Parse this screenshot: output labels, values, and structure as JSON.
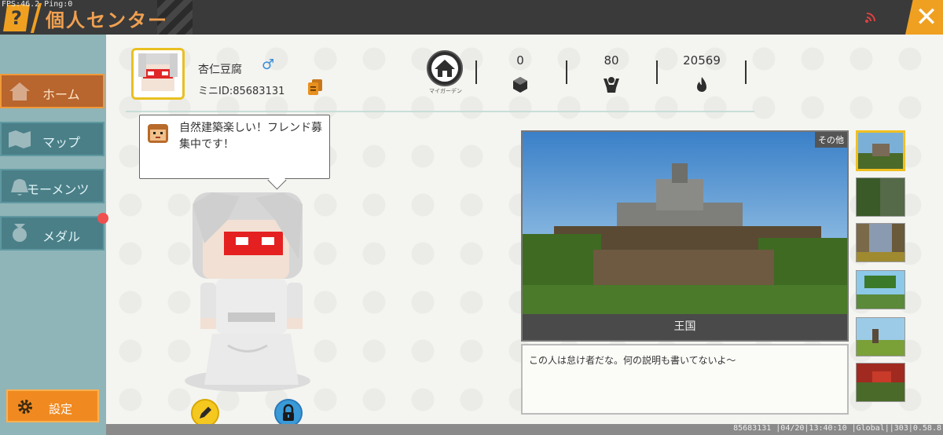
{
  "debug": {
    "fps_text": "FPS:46.2  Ping:0"
  },
  "header": {
    "help_glyph": "?",
    "title": "個人センター",
    "close_glyph": "✕"
  },
  "sidebar": {
    "items": [
      {
        "label": "ホーム",
        "icon": "home-icon",
        "active": true
      },
      {
        "label": "マップ",
        "icon": "map-icon",
        "active": false
      },
      {
        "label": "モーメンツ",
        "icon": "moments-icon",
        "active": false
      },
      {
        "label": "メダル",
        "icon": "medal-icon",
        "active": false
      }
    ],
    "settings_label": "設定"
  },
  "profile": {
    "name": "杏仁豆腐",
    "gender_glyph": "♂",
    "id_text": "ミニID:85683131",
    "home_label": "マイガーデン",
    "stats": [
      {
        "value": "0",
        "icon": "block-icon"
      },
      {
        "value": "80",
        "icon": "fans-icon"
      },
      {
        "value": "20569",
        "icon": "fire-icon"
      }
    ]
  },
  "bubble": {
    "text": "自然建築楽しい！フレンド募集中です！"
  },
  "map": {
    "tag": "その他",
    "name": "王国",
    "description": "この人は怠け者だな。何の説明も書いてないよ〜"
  },
  "footer": {
    "info": "85683131   |04/20|13:40:10  |Global||303|0.58.8"
  },
  "colors": {
    "accent": "#f0a020",
    "sidebar": "#4a7f88",
    "active": "#b8652e"
  }
}
